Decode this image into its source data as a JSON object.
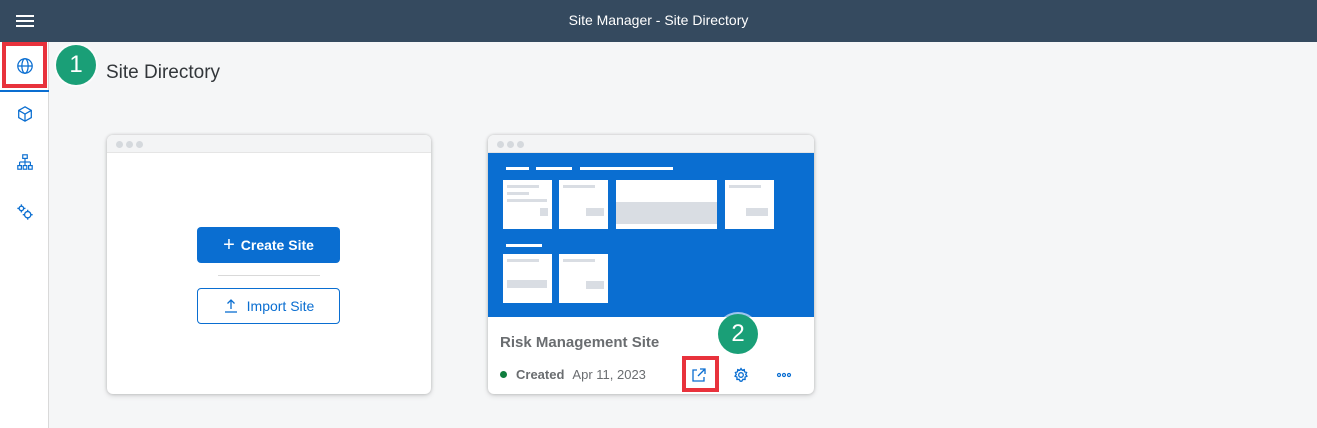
{
  "header": {
    "title": "Site Manager - Site Directory",
    "menu_icon": "hamburger-icon"
  },
  "sidebar": {
    "items": [
      {
        "name": "site-directory",
        "icon": "globe-icon",
        "active": true
      },
      {
        "name": "content-manager",
        "icon": "cube-icon",
        "active": false
      },
      {
        "name": "channel-manager",
        "icon": "hierarchy-icon",
        "active": false
      },
      {
        "name": "settings",
        "icon": "gears-icon",
        "active": false
      }
    ]
  },
  "page": {
    "title": "Site Directory"
  },
  "new_site_card": {
    "create_label": "Create Site",
    "import_label": "Import Site"
  },
  "site_card": {
    "name": "Risk Management Site",
    "status": "Created",
    "date": "Apr 11, 2023",
    "status_color": "#107e3e"
  },
  "annotations": {
    "step1": "1",
    "step2": "2",
    "badge_color": "#1a9f77",
    "highlight_color": "#e8323c"
  },
  "colors": {
    "shell": "#354a5f",
    "accent": "#0a6ed1"
  }
}
